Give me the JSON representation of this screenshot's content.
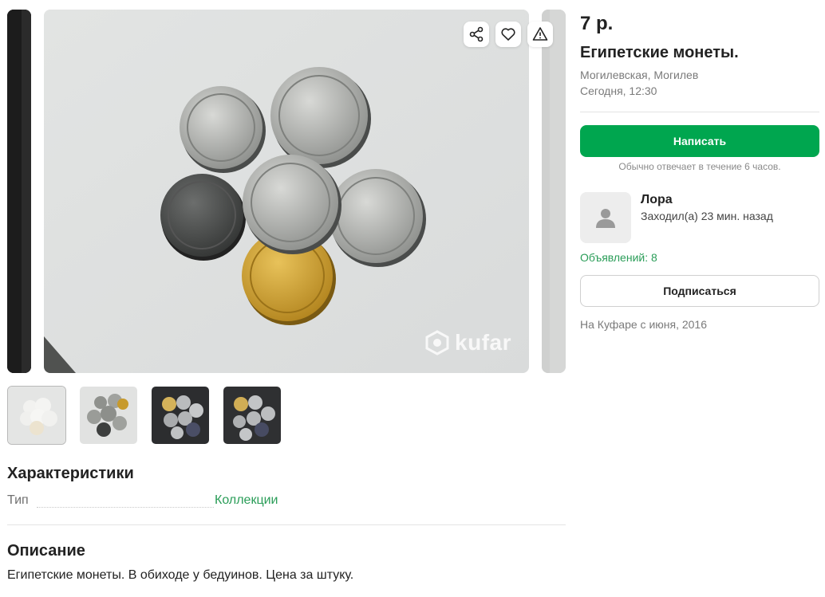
{
  "listing": {
    "price": "7 р.",
    "title": "Египетские монеты.",
    "location": "Могилевская, Могилев",
    "date": "Сегодня, 12:30",
    "watermark": "kufar"
  },
  "actions": {
    "share_icon": "share-icon",
    "favorite_icon": "heart-icon",
    "report_icon": "warning-icon"
  },
  "contact": {
    "write_label": "Написать",
    "reply_note": "Обычно отвечает в течение 6 часов."
  },
  "seller": {
    "name": "Лора",
    "last_seen": "Заходил(а) 23 мин. назад",
    "ads_count": "Объявлений: 8",
    "subscribe_label": "Подписаться",
    "member_since": "На Куфаре с июня, 2016"
  },
  "characteristics": {
    "title": "Характеристики",
    "rows": [
      {
        "key": "Тип",
        "value": "Коллекции"
      }
    ]
  },
  "description": {
    "title": "Описание",
    "text": "Египетские монеты. В обиходе у бедуинов. Цена за штуку."
  },
  "colors": {
    "accent": "#00a64f",
    "link": "#2a9d58"
  }
}
